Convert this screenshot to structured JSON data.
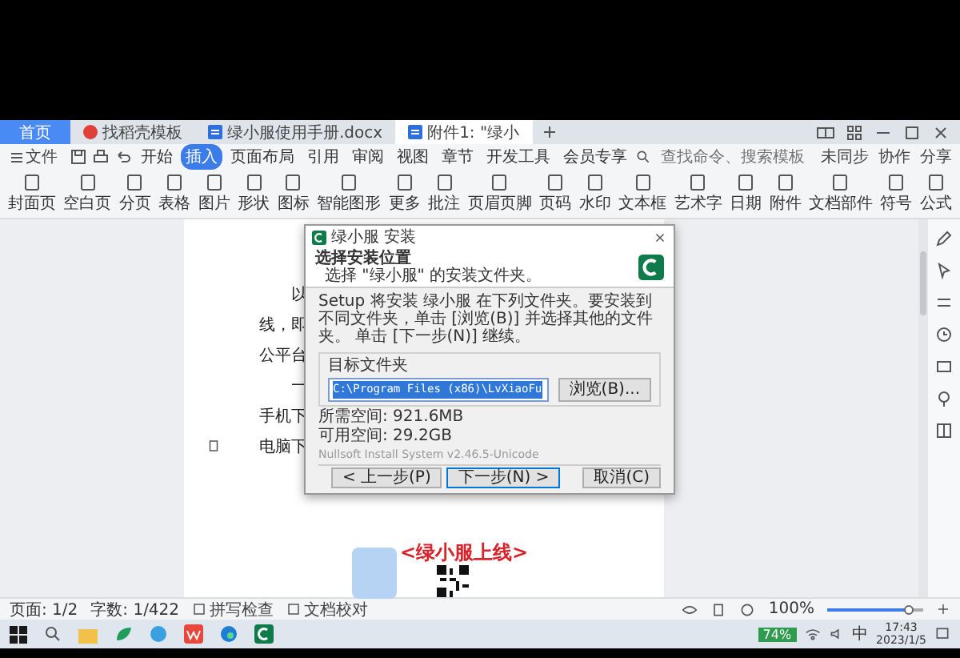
{
  "tabs": [
    {
      "label": "首页",
      "selected": false,
      "kind": "home"
    },
    {
      "label": "找稻壳模板",
      "selected": false,
      "kind": "docer"
    },
    {
      "label": "绿小服使用手册.docx",
      "selected": false,
      "kind": "doc"
    },
    {
      "label": "附件1: \"绿小",
      "selected": true,
      "kind": "doc"
    }
  ],
  "menu": {
    "file": "文件",
    "tabs": [
      {
        "label": "开始",
        "selected": false
      },
      {
        "label": "插入",
        "selected": true
      },
      {
        "label": "页面布局",
        "selected": false
      },
      {
        "label": "引用",
        "selected": false
      },
      {
        "label": "审阅",
        "selected": false
      },
      {
        "label": "视图",
        "selected": false
      },
      {
        "label": "章节",
        "selected": false
      },
      {
        "label": "开发工具",
        "selected": false
      },
      {
        "label": "会员专享",
        "selected": false
      }
    ],
    "search": {
      "placeholder": "查找命令、搜索模板"
    },
    "actions": [
      "未同步",
      "协作",
      "分享"
    ]
  },
  "ribbon": [
    "封面页",
    "空白页",
    "分页",
    "表格",
    "图片",
    "形状",
    "图标",
    "智能图形",
    "更多",
    "批注",
    "页眉页脚",
    "页码",
    "水印",
    "文本框",
    "艺术字",
    "日期",
    "附件",
    "文档部件",
    "符号",
    "公式"
  ],
  "document": {
    "lines": [
      "以",
      "线，即",
      "公平台",
      "一",
      "手机下",
      "电脑下"
    ],
    "banner": "<绿小服上线>"
  },
  "dialog": {
    "title": "绿小服 安装",
    "heading": "选择安装位置",
    "subheading": "选择 \"绿小服\" 的安装文件夹。",
    "body": "Setup 将安装 绿小服 在下列文件夹。要安装到不同文件夹，单击 [浏览(B)] 并选择其他的文件夹。 单击 [下一步(N)] 继续。",
    "group": "目标文件夹",
    "path": "C:\\Program Files (x86)\\LvXiaoFu",
    "browse": "浏览(B)...",
    "space": [
      "所需空间: 921.6MB",
      "可用空间: 29.2GB"
    ],
    "branding": "Nullsoft Install System v2.46.5-Unicode",
    "buttons": [
      {
        "label": "< 上一步(P)",
        "selected": false
      },
      {
        "label": "下一步(N) >",
        "selected": true
      },
      {
        "label": "取消(C)",
        "selected": false
      }
    ]
  },
  "status_bar": {
    "page": "页面: 1/2",
    "words": "字数: 1/422",
    "spell": "拼写检查",
    "proof": "文档校对",
    "zoom": "100%",
    "zoom_slider": {
      "level": 0.85
    }
  },
  "taskbar": {
    "battery": "74%",
    "ime": "中",
    "time": "17:43",
    "date": "2023/1/5"
  }
}
